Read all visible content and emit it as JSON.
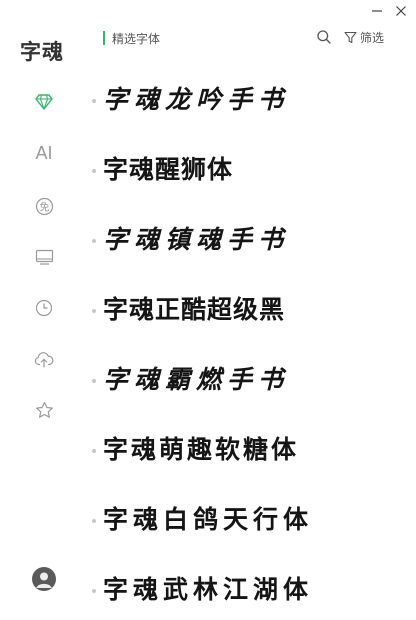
{
  "app": {
    "logo_text": "字魂"
  },
  "window": {
    "minimize_label": "−",
    "close_label": "×"
  },
  "sidebar": {
    "items": [
      {
        "id": "featured",
        "icon": "diamond-icon",
        "active": true
      },
      {
        "id": "ai",
        "label": "AI",
        "active": false
      },
      {
        "id": "free",
        "label": "免",
        "icon": "free-icon",
        "active": false
      },
      {
        "id": "screen",
        "icon": "monitor-icon",
        "active": false
      },
      {
        "id": "history",
        "icon": "clock-icon",
        "active": false
      },
      {
        "id": "upload",
        "icon": "cloud-upload-icon",
        "active": false
      },
      {
        "id": "favorites",
        "icon": "star-icon",
        "active": false
      }
    ],
    "accent_color": "#36b36c"
  },
  "header": {
    "title": "精选字体",
    "filter_label": "筛选"
  },
  "fonts": [
    {
      "name": "字魂龙吟手书",
      "style": "brush"
    },
    {
      "name": "字魂醒狮体",
      "style": "heavy"
    },
    {
      "name": "字魂镇魂手书",
      "style": "brush"
    },
    {
      "name": "字魂正酷超级黑",
      "style": "heavy"
    },
    {
      "name": "字魂霸燃手书",
      "style": "brush"
    },
    {
      "name": "字魂萌趣软糖体",
      "style": "bold"
    },
    {
      "name": "字魂白鸽天行体",
      "style": "calli"
    },
    {
      "name": "字魂武林江湖体",
      "style": "calli"
    }
  ]
}
